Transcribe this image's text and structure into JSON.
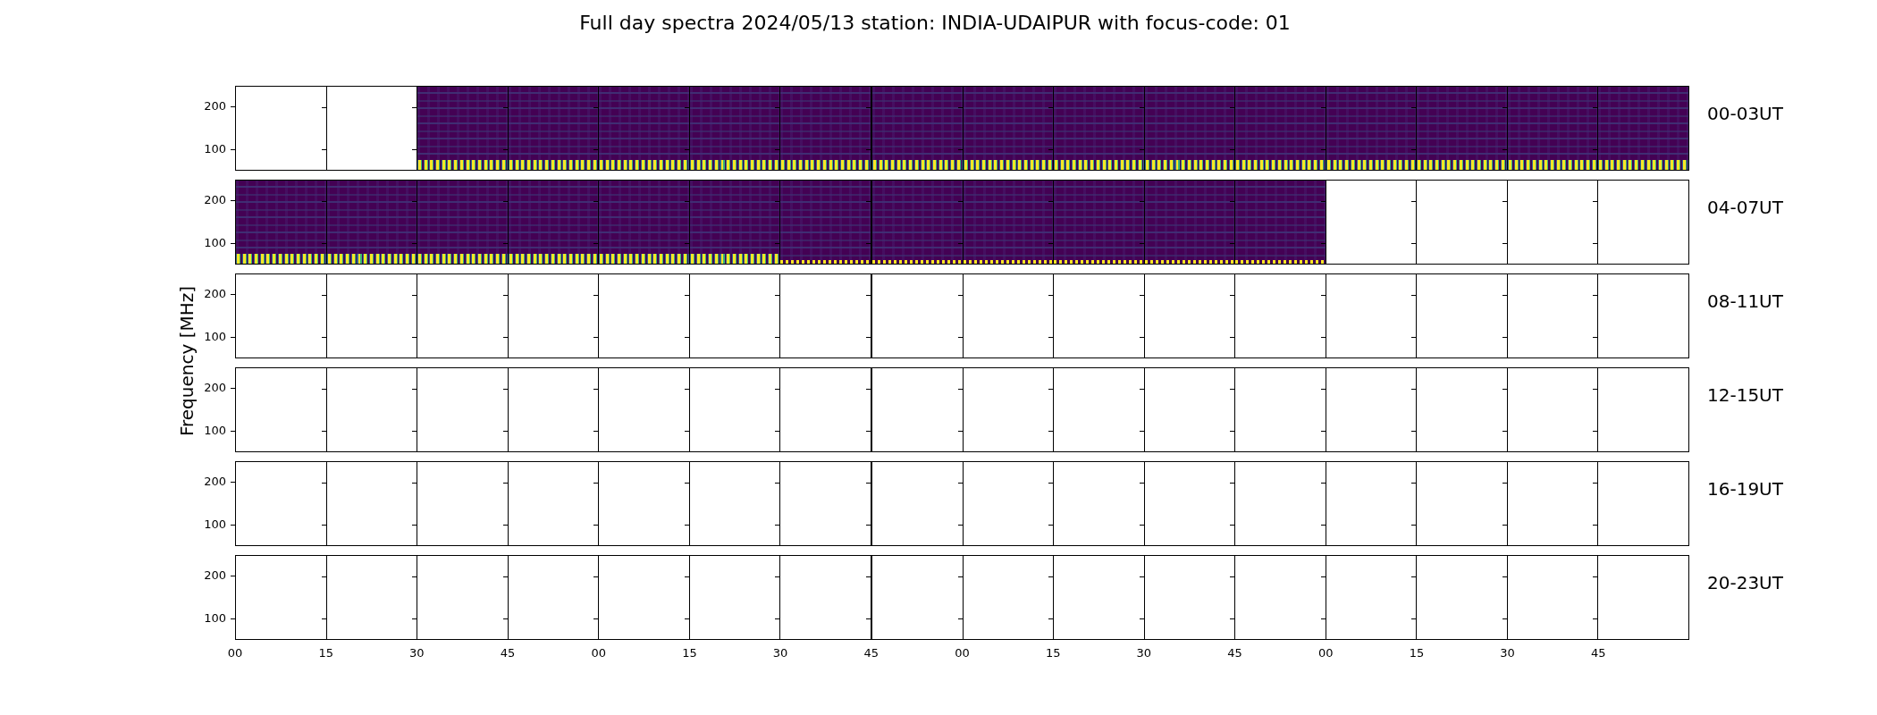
{
  "title": "Full day spectra 2024/05/13 station: INDIA-UDAIPUR with focus-code: 01",
  "y_axis_label": "Frequency [MHz]",
  "rows": [
    {
      "label": "00-03UT",
      "y_ticks": [
        "200",
        "100"
      ],
      "panels": [
        {
          "kind": "empty"
        },
        {
          "kind": "empty"
        },
        {
          "kind": "coarse"
        },
        {
          "kind": "coarse"
        },
        {
          "kind": "coarse"
        },
        {
          "kind": "coarse"
        },
        {
          "kind": "coarse"
        },
        {
          "kind": "coarse"
        },
        {
          "kind": "coarse"
        },
        {
          "kind": "coarse"
        },
        {
          "kind": "coarse"
        },
        {
          "kind": "coarse"
        },
        {
          "kind": "coarse"
        },
        {
          "kind": "coarse"
        },
        {
          "kind": "coarse"
        },
        {
          "kind": "coarse"
        }
      ]
    },
    {
      "label": "04-07UT",
      "y_ticks": [
        "200",
        "100"
      ],
      "panels": [
        {
          "kind": "coarse"
        },
        {
          "kind": "coarse"
        },
        {
          "kind": "coarse"
        },
        {
          "kind": "coarse"
        },
        {
          "kind": "coarse"
        },
        {
          "kind": "coarse"
        },
        {
          "kind": "fine"
        },
        {
          "kind": "fine"
        },
        {
          "kind": "fine"
        },
        {
          "kind": "fine"
        },
        {
          "kind": "fine"
        },
        {
          "kind": "fine"
        },
        {
          "kind": "empty"
        },
        {
          "kind": "empty"
        },
        {
          "kind": "empty"
        },
        {
          "kind": "empty"
        }
      ]
    },
    {
      "label": "08-11UT",
      "y_ticks": [
        "200",
        "100"
      ],
      "panels": [
        {
          "kind": "empty"
        },
        {
          "kind": "empty"
        },
        {
          "kind": "empty"
        },
        {
          "kind": "empty"
        },
        {
          "kind": "empty"
        },
        {
          "kind": "empty"
        },
        {
          "kind": "empty"
        },
        {
          "kind": "empty"
        },
        {
          "kind": "empty"
        },
        {
          "kind": "empty"
        },
        {
          "kind": "empty"
        },
        {
          "kind": "empty"
        },
        {
          "kind": "empty"
        },
        {
          "kind": "empty"
        },
        {
          "kind": "empty"
        },
        {
          "kind": "empty"
        }
      ]
    },
    {
      "label": "12-15UT",
      "y_ticks": [
        "200",
        "100"
      ],
      "panels": [
        {
          "kind": "empty"
        },
        {
          "kind": "empty"
        },
        {
          "kind": "empty"
        },
        {
          "kind": "empty"
        },
        {
          "kind": "empty"
        },
        {
          "kind": "empty"
        },
        {
          "kind": "empty"
        },
        {
          "kind": "empty"
        },
        {
          "kind": "empty"
        },
        {
          "kind": "empty"
        },
        {
          "kind": "empty"
        },
        {
          "kind": "empty"
        },
        {
          "kind": "empty"
        },
        {
          "kind": "empty"
        },
        {
          "kind": "empty"
        },
        {
          "kind": "empty"
        }
      ]
    },
    {
      "label": "16-19UT",
      "y_ticks": [
        "200",
        "100"
      ],
      "panels": [
        {
          "kind": "empty"
        },
        {
          "kind": "empty"
        },
        {
          "kind": "empty"
        },
        {
          "kind": "empty"
        },
        {
          "kind": "empty"
        },
        {
          "kind": "empty"
        },
        {
          "kind": "empty"
        },
        {
          "kind": "empty"
        },
        {
          "kind": "empty"
        },
        {
          "kind": "empty"
        },
        {
          "kind": "empty"
        },
        {
          "kind": "empty"
        },
        {
          "kind": "empty"
        },
        {
          "kind": "empty"
        },
        {
          "kind": "empty"
        },
        {
          "kind": "empty"
        }
      ]
    },
    {
      "label": "20-23UT",
      "y_ticks": [
        "200",
        "100"
      ],
      "panels": [
        {
          "kind": "empty"
        },
        {
          "kind": "empty"
        },
        {
          "kind": "empty"
        },
        {
          "kind": "empty"
        },
        {
          "kind": "empty"
        },
        {
          "kind": "empty"
        },
        {
          "kind": "empty"
        },
        {
          "kind": "empty"
        },
        {
          "kind": "empty"
        },
        {
          "kind": "empty"
        },
        {
          "kind": "empty"
        },
        {
          "kind": "empty"
        },
        {
          "kind": "empty"
        },
        {
          "kind": "empty"
        },
        {
          "kind": "empty"
        },
        {
          "kind": "empty"
        }
      ]
    }
  ],
  "x_ticks": [
    "00",
    "15",
    "30",
    "45",
    "00",
    "15",
    "30",
    "45",
    "00",
    "15",
    "30",
    "45",
    "00",
    "15",
    "30",
    "45"
  ]
}
